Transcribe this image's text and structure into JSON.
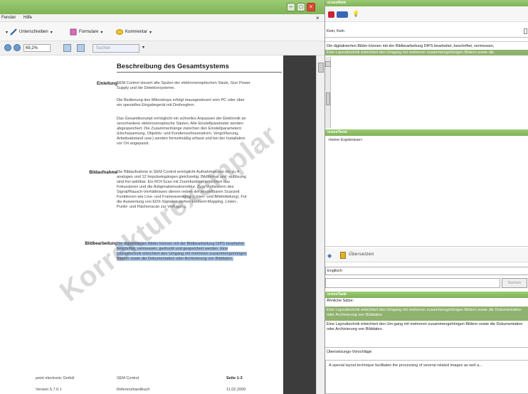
{
  "pdf_viewer": {
    "menu": {
      "fenster": "Fenster",
      "hilfe": "Hilfe"
    },
    "toolbar": {
      "sign": "Unterschreiben",
      "forms": "Formulare",
      "comment": "Kommentar"
    },
    "zoom": "69,2%",
    "search_placeholder": "Suchen"
  },
  "document": {
    "heading": "Beschreibung des Gesamtsystems",
    "sections": {
      "einleitung": "Einleitung",
      "bildaufnahme": "Bildaufnahme",
      "bildbearbeitung": "Bildbearbeitung"
    },
    "paragraphs": {
      "p1": "SEM Control steuert alle Spulen der elektronenoptischen Säule, Gun Power Supply und die Detektorsysteme.",
      "p2": "Die Bedienung des Mikroskops erfolgt mausgesteuert vom PC oder über ein spezielles Eingabegerät mit Drehreglern.",
      "p3": "Das Gesamtkonzept ermöglicht ein schnelles Anpassen der Elektronik an verschiedene elektronenoptische Säulen. Alle Einstellparameter werden abgespeichert. Die Zusammenhänge zwischen den Einstellparametern (Hochspannung, Objektiv- und Kondensorlinsenstrom, Vergrößerung, Arbeitsabstand usw.) werden formelmäßig erfasst und bei der Installation vor Ort angepasst.",
      "p4": "Die Bildaufnahme in SEM Control ermöglicht Aufnahmen von bis zu 4 analogen und 12 Impulseingängen gleichzeitig. Bildformat und -auflösung sind frei wählbar. Ein ROI-Scan mit Zoomfunktion erleichtert das Fokussieren und die Astigmatismuskorrektur. Zum Verbessern des Signal/Rausch-Verhältnisses dienen neben der einstellbaren Scanzeit Funktionen wie Line- und Frameaveraging (Linien- und Bildmittelung). Für die Auswertung von EDX-Signalen stehen Element-Mapping, Linien-, Punkt- und Flächenscan zur Verfügung.",
      "p5": "Die digitalisierten Bilder können mit der Bildbearbeitung DIPS bearbeitet, beschriftet, vermessen, gedruckt und gespeichert werden. Eine Layouttechnik erleichtert den Umgang mit mehreren zusammengehörigen Bildern sowie die Dokumentation oder Archivierung von Bilddaten."
    },
    "footer": {
      "company": "point electronic GmbH",
      "product": "SEM Control",
      "page": "Seite 1-3",
      "version": "Version 5.7.0.1",
      "manual": "Referenzhandbuch",
      "date": "11.02.2009"
    },
    "watermark": "Korrekturexemplar"
  },
  "crossweb": {
    "title": "crossWeb",
    "status": "Kein, Kein",
    "line1": "Die digitalisierten Bilder können mit der Bildbearbeitung DIPS bearbeitet, beschriftet, vermessen,",
    "line2": "Eine Layouttechnik erleichtert den Umgang mit mehreren zusammengehörigen Bildern sowie die"
  },
  "crossterm": {
    "title": "crossTerm",
    "no_results": "<keine Ergebnisse>",
    "toolbar_label": "Übersetzen"
  },
  "lookup": {
    "language": "Englisch",
    "search_button": "Suchen"
  },
  "crosstank": {
    "title": "crossTank",
    "similar_label": "Ähnliche Sätze:",
    "match_highlighted": "Eine Layouttechnik erleichtert den Umgang mit mehreren zusammengehörigen Bildern sowie die Dokumentation oder Archivierung von Bilddaten.",
    "match_plain": "Eine Layouttechnik erleichtert den Um-gang mit mehreren zusammengehörigen Bildern sowie die Dokumentation oder Archivierung von Bilddaten.",
    "suggestions_label": "Übersetzungs-Vorschläge:",
    "suggestion": "A special layout technique facilitates the processing of several related images as well a..."
  },
  "colors": {
    "title_green": "#7fb356",
    "highlight_green": "#8fb26e",
    "selection_blue": "#a9c6ea"
  }
}
